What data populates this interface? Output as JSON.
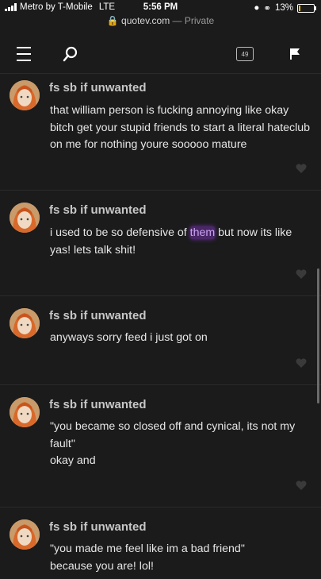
{
  "status_bar": {
    "carrier": "Metro by T-Mobile",
    "network": "LTE",
    "time": "5:56 PM",
    "battery": "13%",
    "battery_level": 0.13
  },
  "url_bar": {
    "host": "quotev.com",
    "mode": "— Private"
  },
  "nav": {
    "notification_count": "49"
  },
  "posts": [
    {
      "author": "fs sb if unwanted",
      "text": "that william person is fucking annoying like okay bitch get your stupid friends to start a literal hateclub on me for nothing youre sooooo mature"
    },
    {
      "author": "fs sb if unwanted",
      "text_before": "i used to be so defensive of ",
      "text_highlight": "them",
      "text_after": " but now its like yas! lets talk shit!"
    },
    {
      "author": "fs sb if unwanted",
      "text": "anyways sorry feed i just got on"
    },
    {
      "author": "fs sb if unwanted",
      "text": "\"you became so closed off and cynical, its not my fault\"\nokay and"
    },
    {
      "author": "fs sb if unwanted",
      "text": "\"you made me feel like im a bad friend\"\nbecause you are! lol!"
    }
  ],
  "colors": {
    "background": "#1b1b1b",
    "highlight": "#4a2766"
  }
}
